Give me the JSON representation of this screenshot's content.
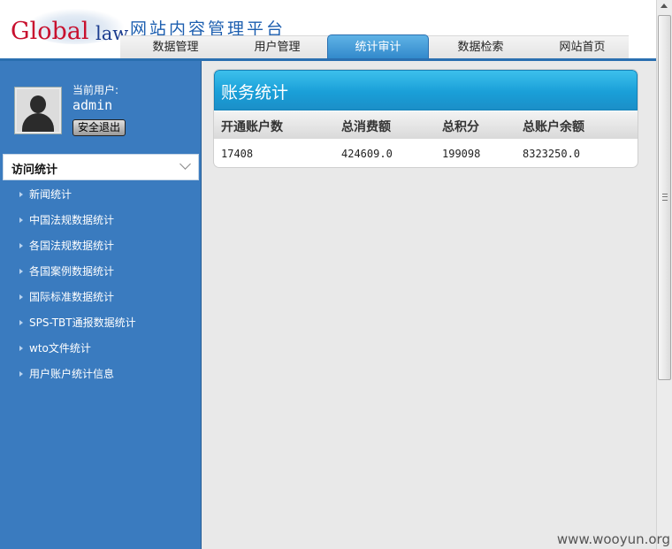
{
  "header": {
    "logo_word1": "Global",
    "logo_word2": "law",
    "platform_title": "网站内容管理平台"
  },
  "nav": {
    "tabs": [
      {
        "label": "数据管理"
      },
      {
        "label": "用户管理"
      },
      {
        "label": "统计审计",
        "active": true
      },
      {
        "label": "数据检索"
      },
      {
        "label": "网站首页"
      }
    ]
  },
  "user": {
    "label": "当前用户:",
    "name": "admin",
    "logout_label": "安全退出"
  },
  "sidebar": {
    "section_title": "访问统计",
    "items": [
      {
        "label": "新闻统计"
      },
      {
        "label": "中国法规数据统计"
      },
      {
        "label": "各国法规数据统计"
      },
      {
        "label": "各国案例数据统计"
      },
      {
        "label": "国际标准数据统计"
      },
      {
        "label": "SPS-TBT通报数据统计"
      },
      {
        "label": "wto文件统计"
      },
      {
        "label": "用户账户统计信息"
      }
    ]
  },
  "panel": {
    "title": "账务统计",
    "columns": [
      "开通账户数",
      "总消费额",
      "总积分",
      "总账户余额"
    ],
    "rows": [
      [
        "17408",
        "424609.0",
        "199098",
        "8323250.0"
      ]
    ]
  },
  "watermark": "www.wooyun.org",
  "colors": {
    "sidebar_bg": "#3a7bbf",
    "accent": "#1a9fd8",
    "nav_active": "#2f86c9"
  }
}
